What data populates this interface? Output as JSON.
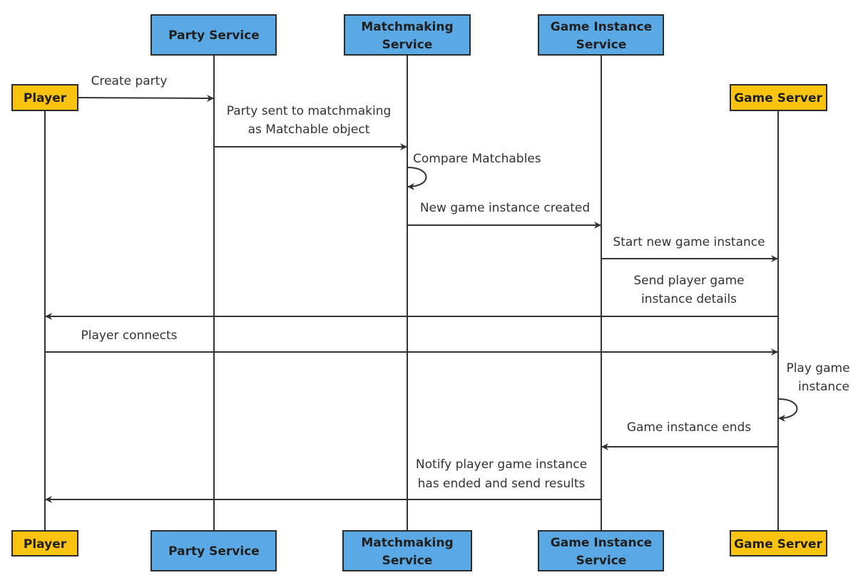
{
  "colors": {
    "service": "#5aa9e4",
    "actor": "#f9c30f",
    "line": "#333333"
  },
  "participants": {
    "player": {
      "lines": [
        "Player"
      ]
    },
    "party": {
      "lines": [
        "Party Service"
      ]
    },
    "matchmaking": {
      "lines": [
        "Matchmaking",
        "Service"
      ]
    },
    "game_instance": {
      "lines": [
        "Game Instance",
        "Service"
      ]
    },
    "game_server": {
      "lines": [
        "Game Server"
      ]
    }
  },
  "messages": [
    {
      "from": "player",
      "to": "party",
      "lines": [
        "Create party"
      ]
    },
    {
      "from": "party",
      "to": "matchmaking",
      "lines": [
        "Party sent to matchmaking",
        "as Matchable object"
      ]
    },
    {
      "from": "matchmaking",
      "to": "matchmaking",
      "lines": [
        "Compare Matchables"
      ]
    },
    {
      "from": "matchmaking",
      "to": "game_instance",
      "lines": [
        "New game instance created"
      ]
    },
    {
      "from": "game_instance",
      "to": "game_server",
      "lines": [
        "Start new game instance"
      ]
    },
    {
      "from": "game_server",
      "to": "player",
      "lines": [
        "Send player game",
        "instance details"
      ]
    },
    {
      "from": "player",
      "to": "game_server",
      "lines": [
        "Player connects"
      ]
    },
    {
      "from": "game_server",
      "to": "game_server",
      "lines": [
        "Play game",
        "instance"
      ]
    },
    {
      "from": "game_server",
      "to": "game_instance",
      "lines": [
        "Game instance ends"
      ]
    },
    {
      "from": "game_instance",
      "to": "player",
      "lines": [
        "Notify player game instance",
        "has ended and send results"
      ]
    }
  ]
}
